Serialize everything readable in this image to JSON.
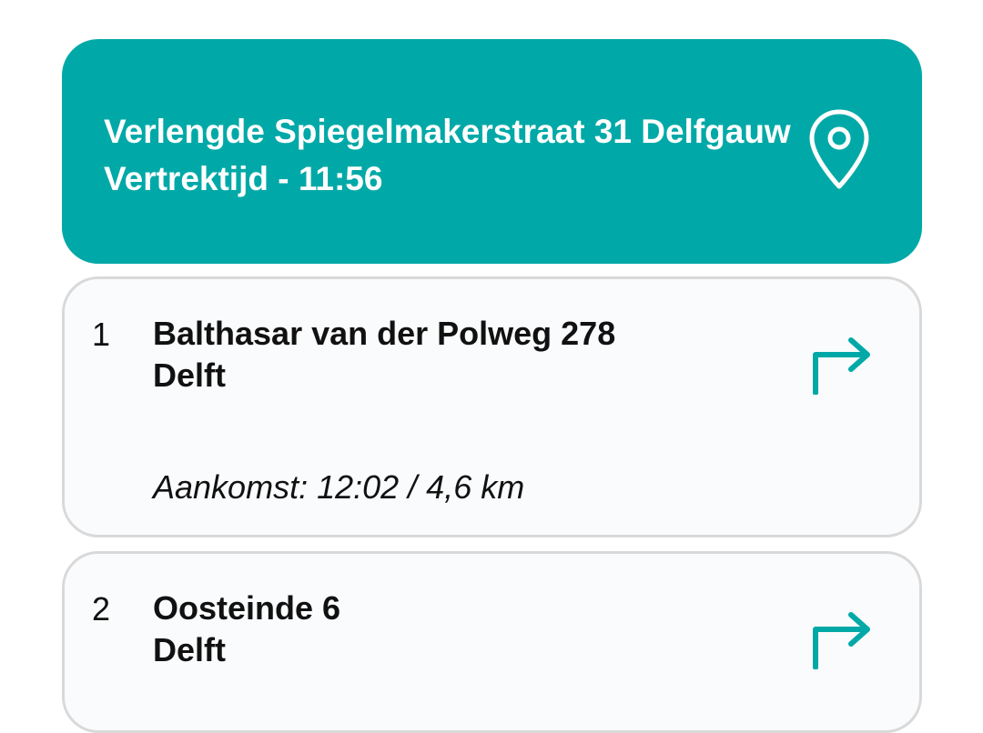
{
  "origin": {
    "address": "Verlengde Spiegelmakerstraat 31 Delfgauw",
    "departure": "Vertrektijd - 11:56",
    "icon": "location-pin-icon"
  },
  "stops": [
    {
      "index": "1",
      "street": "Balthasar van der Polweg 278",
      "city": "Delft",
      "arrival": "Aankomst: 12:02 / 4,6 km",
      "icon": "turn-right-icon"
    },
    {
      "index": "2",
      "street": "Oosteinde 6",
      "city": "Delft",
      "icon": "turn-right-icon"
    }
  ],
  "colors": {
    "accent": "#00a9a7",
    "card_background": "#fafbfc",
    "card_border": "#d9d9d9",
    "text": "#111111"
  }
}
